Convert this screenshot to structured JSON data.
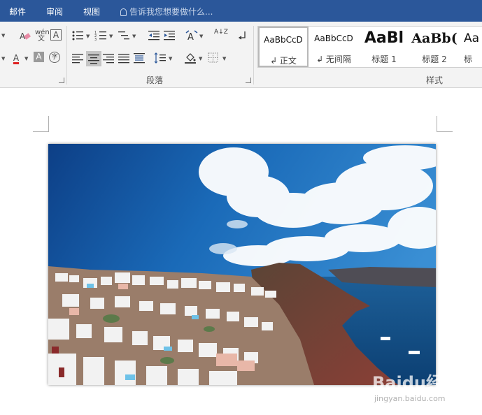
{
  "topbar": {
    "tabs": [
      "邮件",
      "审阅",
      "视图"
    ],
    "tell_me": "告诉我您想要做什么..."
  },
  "ribbon": {
    "font_group": {
      "phonetic_glyph": "wén文",
      "border_char_glyph": "A",
      "font_color_glyph": "A",
      "char_shading_glyph": "A",
      "enclose_glyph": "字",
      "font_color_hex": "#e02020"
    },
    "paragraph_group": {
      "label": "段落",
      "sort_glyph": "A↓Z"
    },
    "styles_group": {
      "label": "样式",
      "items": [
        {
          "preview": "AaBbCcD",
          "name": "↲ 正文"
        },
        {
          "preview": "AaBbCcD",
          "name": "↲ 无间隔"
        },
        {
          "preview": "AaBl",
          "name": "标题 1"
        },
        {
          "preview": "AaBb(",
          "name": "标题 2"
        },
        {
          "preview": "Aa",
          "name": "标"
        }
      ]
    }
  },
  "watermark": {
    "brand": "Baidu经验",
    "url": "jingyan.baidu.com"
  }
}
